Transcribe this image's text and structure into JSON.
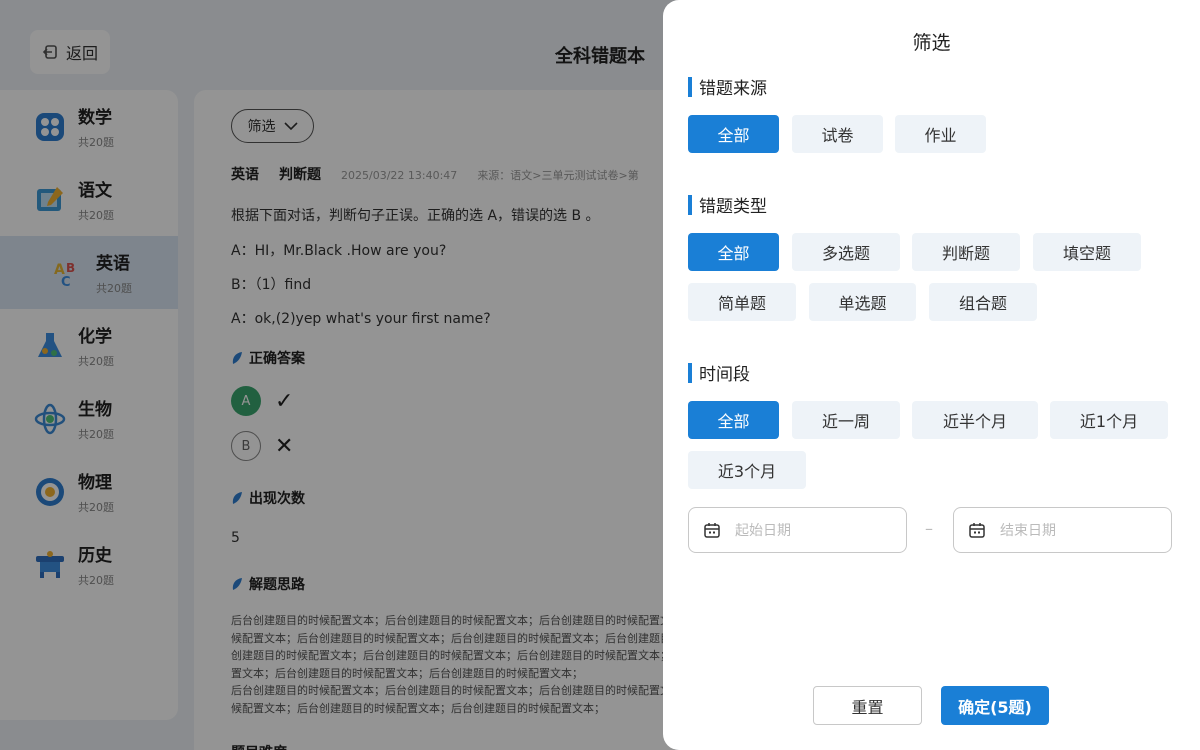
{
  "header": {
    "back_label": "返回",
    "title": "全科错题本"
  },
  "sidebar": {
    "items": [
      {
        "name": "数学",
        "count": "共20题",
        "icon": "math-icon",
        "color": "#2f7fd0"
      },
      {
        "name": "语文",
        "count": "共20题",
        "icon": "chinese-icon",
        "color": "#3d9ad6"
      },
      {
        "name": "英语",
        "count": "共20题",
        "icon": "english-icon",
        "color": "#e6b634",
        "active": true
      },
      {
        "name": "化学",
        "count": "共20题",
        "icon": "chemistry-icon",
        "color": "#3d8ee0"
      },
      {
        "name": "生物",
        "count": "共20题",
        "icon": "biology-icon",
        "color": "#3b8bd6"
      },
      {
        "name": "物理",
        "count": "共20题",
        "icon": "physics-icon",
        "color": "#2f7fd0"
      },
      {
        "name": "历史",
        "count": "共20题",
        "icon": "history-icon",
        "color": "#2f6fbf"
      }
    ]
  },
  "content": {
    "filter_label": "筛选",
    "meta": {
      "subject": "英语",
      "type": "判断题",
      "date": "2025/03/22 13:40:47",
      "source": "来源：语文>三单元测试试卷>第"
    },
    "question_lines": [
      "根据下面对话，判断句子正误。正确的选 A，错误的选 B 。",
      "A：HI，Mr.Black .How are  you?",
      "B：（1）find",
      "A：ok,(2)yep  what's your first name?"
    ],
    "answer_heading": "正确答案",
    "options": [
      {
        "letter": "A",
        "mark": "✓"
      },
      {
        "letter": "B",
        "mark": "✕"
      }
    ],
    "count_heading": "出现次数",
    "count_value": "5",
    "analysis_heading": "解题思路",
    "analysis_lines": [
      "后台创建题目的时候配置文本；后台创建题目的时候配置文本；后台创建题目的时候配置文本；",
      "候配置文本；后台创建题目的时候配置文本；后台创建题目的时候配置文本；后台创建题目的时",
      "创建题目的时候配置文本；后台创建题目的时候配置文本；后台创建题目的时候配置文本；后台",
      "置文本；后台创建题目的时候配置文本；后台创建题目的时候配置文本；",
      "后台创建题目的时候配置文本；后台创建题目的时候配置文本；后台创建题目的时候配置文本；",
      "候配置文本；后台创建题目的时候配置文本；后台创建题目的时候配置文本；"
    ],
    "next_heading": "题目难度"
  },
  "drawer": {
    "title": "筛选",
    "source": {
      "title": "错题来源",
      "options": [
        "全部",
        "试卷",
        "作业"
      ]
    },
    "type": {
      "title": "错题类型",
      "options": [
        "全部",
        "多选题",
        "判断题",
        "填空题",
        "简单题",
        "单选题",
        "组合题"
      ]
    },
    "period": {
      "title": "时间段",
      "options": [
        "全部",
        "近一周",
        "近半个月",
        "近1个月",
        "近3个月"
      ]
    },
    "start_placeholder": "起始日期",
    "end_placeholder": "结束日期",
    "separator": "–",
    "reset_label": "重置",
    "confirm_label": "确定(5题)"
  },
  "colors": {
    "accent": "#1a7fd6",
    "chip_bg": "#eef3f8",
    "correct": "#3aa66e"
  }
}
